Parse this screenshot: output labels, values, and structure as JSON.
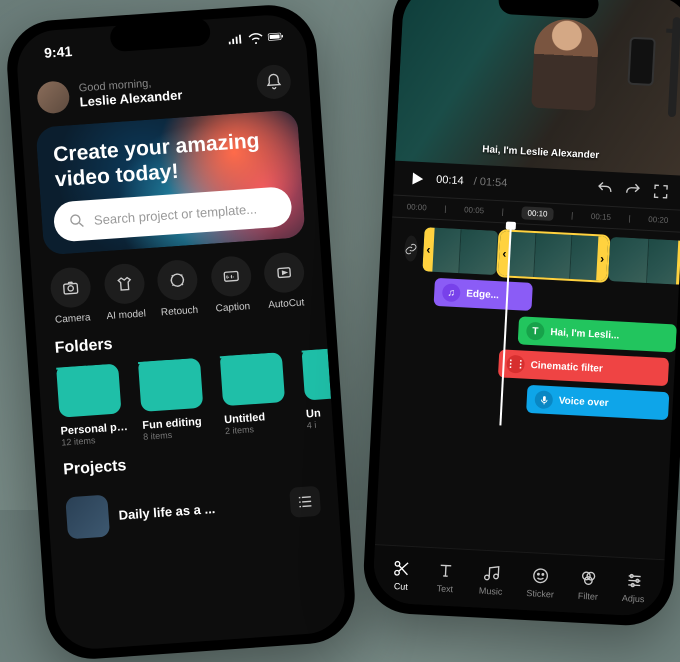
{
  "statusbar": {
    "time": "9:41"
  },
  "greeting": {
    "line1": "Good morning,",
    "name": "Leslie Alexander"
  },
  "hero": {
    "title": "Create your amazing video today!"
  },
  "search": {
    "placeholder": "Search project or template..."
  },
  "tools": [
    {
      "label": "Camera",
      "icon": "camera-icon"
    },
    {
      "label": "AI model",
      "icon": "shirt-icon"
    },
    {
      "label": "Retouch",
      "icon": "retouch-icon"
    },
    {
      "label": "Caption",
      "icon": "caption-icon"
    },
    {
      "label": "AutoCut",
      "icon": "autocut-icon"
    }
  ],
  "sections": {
    "folders": "Folders",
    "projects": "Projects"
  },
  "folders": [
    {
      "name": "Personal proj...",
      "items": "12 items"
    },
    {
      "name": "Fun editing",
      "items": "8 items"
    },
    {
      "name": "Untitled",
      "items": "2 items"
    },
    {
      "name": "Un",
      "items": "4 i"
    }
  ],
  "projects": [
    {
      "title": "Daily life as a ..."
    }
  ],
  "editor": {
    "caption": "Hai, I'm Leslie Alexander",
    "time_current": "00:14",
    "time_total": "/ 01:54",
    "ruler": [
      "00:00",
      "00:05",
      "00:10",
      "00:15",
      "00:20"
    ],
    "ruler_active": "00:10",
    "lanes": {
      "audio": "Edge...",
      "caption": "Hai, I'm Lesli...",
      "filter": "Cinematic filter",
      "voice": "Voice over"
    },
    "bottombar": [
      {
        "label": "Cut",
        "icon": "scissors-icon"
      },
      {
        "label": "Text",
        "icon": "text-icon"
      },
      {
        "label": "Music",
        "icon": "music-icon"
      },
      {
        "label": "Sticker",
        "icon": "sticker-icon"
      },
      {
        "label": "Filter",
        "icon": "filter-icon"
      },
      {
        "label": "Adjus",
        "icon": "adjust-icon"
      }
    ]
  }
}
